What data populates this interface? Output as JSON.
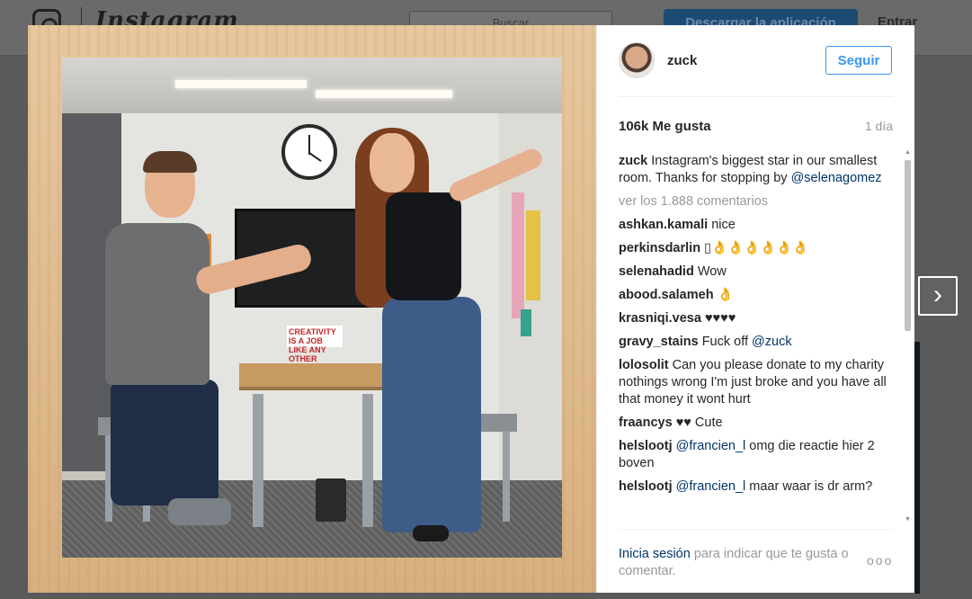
{
  "header": {
    "logo": "Instagram",
    "search_placeholder": "Buscar",
    "download_label": "Descargar la aplicación",
    "login_label": "Entrar"
  },
  "post": {
    "username": "zuck",
    "follow_label": "Seguir",
    "likes": "106k Me gusta",
    "time": "1 día",
    "photo_sign": "CREATIVITY IS A JOB LIKE ANY OTHER",
    "caption": {
      "user": "zuck",
      "text": "Instagram's biggest star in our smallest room. Thanks for stopping by ",
      "mention": "@selenagomez"
    },
    "view_all": "ver los 1.888 comentarios",
    "comments": [
      {
        "user": "ashkan.kamali",
        "text": "nice"
      },
      {
        "user": "perkinsdarlin",
        "text": "▯👌👌👌👌👌👌"
      },
      {
        "user": "selenahadid",
        "text": "Wow"
      },
      {
        "user": "abood.salameh",
        "text": "👌"
      },
      {
        "user": "krasniqi.vesa",
        "text": "♥♥♥♥"
      },
      {
        "user": "gravy_stains",
        "text": "Fuck off ",
        "mention": "@zuck"
      },
      {
        "user": "lolosolit",
        "text": "Can you please donate to my charity nothings wrong I'm just broke and you have all that money it wont hurt"
      },
      {
        "user": "fraancys",
        "text": "♥♥ Cute"
      },
      {
        "user": "helslootj",
        "mention": "@francien_l",
        "text_after": " omg die reactie hier 2 boven"
      },
      {
        "user": "helslootj",
        "mention": "@francien_l",
        "text_after": " maar waar is dr arm?"
      }
    ],
    "footer": {
      "login_link": "Inicia sesión",
      "login_text": " para indicar que te gusta o comentar.",
      "more": "ooo"
    }
  },
  "nav": {
    "next_symbol": "›"
  },
  "colors": {
    "accent": "#3897f0",
    "link": "#003569",
    "muted": "#999999"
  }
}
